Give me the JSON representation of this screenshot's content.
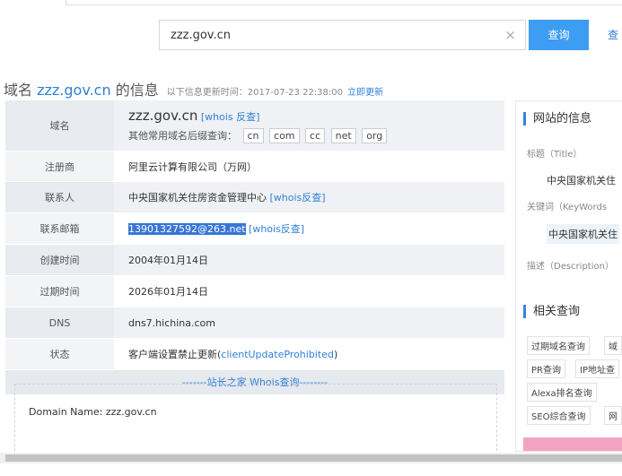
{
  "search": {
    "value": "zzz.gov.cn",
    "clear_icon": "×",
    "button": "查询",
    "second_link": "查"
  },
  "heading": {
    "prefix": "域名",
    "domain": "zzz.gov.cn",
    "suffix": "的信息",
    "subtitle": "以下信息更新时间：2017-07-23 22:38:00",
    "update_link": "立即更新"
  },
  "table": {
    "domain": {
      "label": "域名",
      "value": "zzz.gov.cn",
      "whois_link": "[whois 反查]",
      "suffix_text": "其他常用域名后缀查询：",
      "suffixes": [
        "cn",
        "com",
        "cc",
        "net",
        "org"
      ]
    },
    "registrar": {
      "label": "注册商",
      "value": "阿里云计算有限公司（万网）"
    },
    "contact": {
      "label": "联系人",
      "value": "中央国家机关住房资金管理中心",
      "link": "[whois反查]"
    },
    "email": {
      "label": "联系邮箱",
      "value": "13901327592@263.net",
      "link": "[whois反查]"
    },
    "created": {
      "label": "创建时间",
      "value": "2004年01月14日"
    },
    "expires": {
      "label": "过期时间",
      "value": "2026年01月14日"
    },
    "dns": {
      "label": "DNS",
      "value": "dns7.hichina.com"
    },
    "status": {
      "label": "状态",
      "value_prefix": "客户端设置禁止更新(",
      "value_code": "clientUpdateProhibited",
      "value_suffix": ")"
    },
    "whois_bar": "-------站长之家 Whois查询--------",
    "raw_line": "Domain Name: zzz.gov.cn"
  },
  "side": {
    "site_info_title": "网站的信息",
    "title_label": "标题（Title）",
    "title_value": "中央国家机关住",
    "keywords_label": "关键词（KeyWords",
    "keywords_value": "中央国家机关住",
    "description_label": "描述（Description）",
    "related_title": "相关查询",
    "chips": [
      "过期域名查询",
      "域",
      "PR查询",
      "IP地址查",
      "Alexa排名查询",
      "",
      "SEO综合查询",
      "网"
    ]
  }
}
